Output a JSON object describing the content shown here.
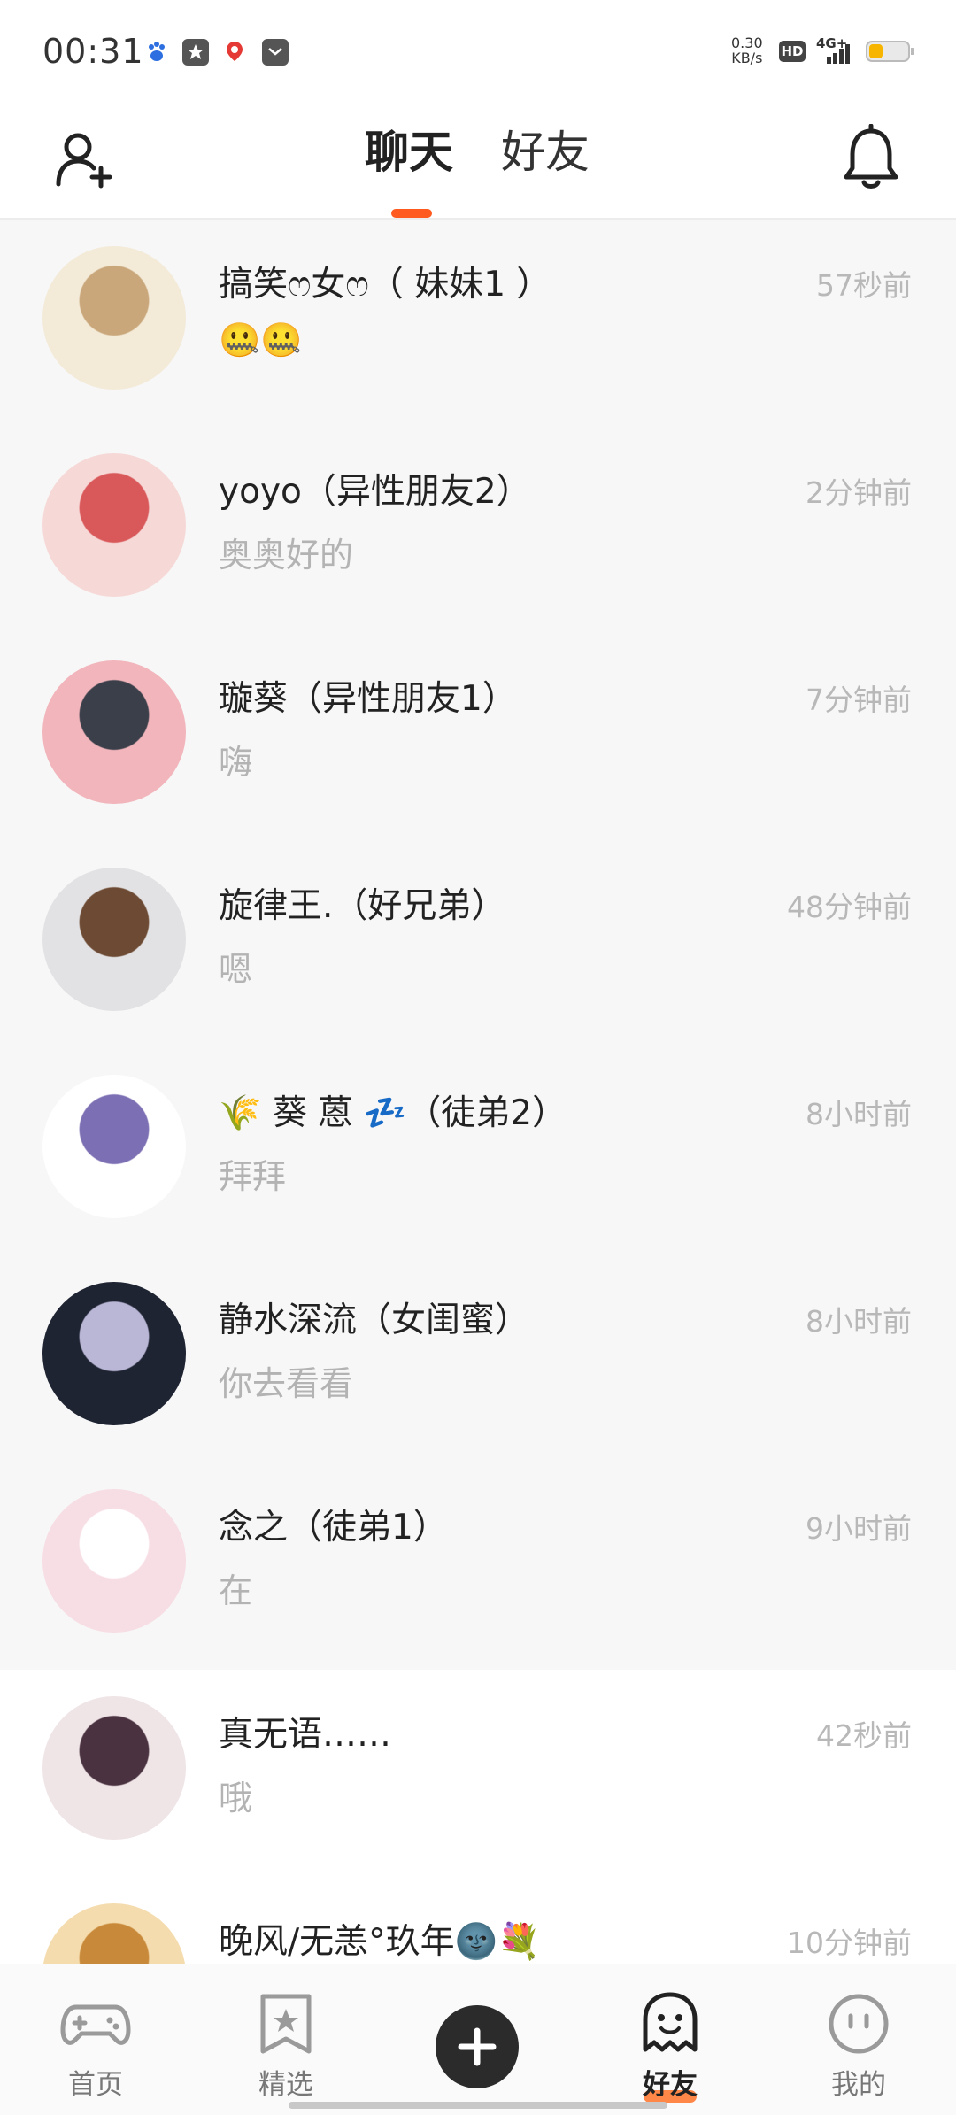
{
  "status_bar": {
    "time": "00:31",
    "net_speed_value": "0.30",
    "net_speed_unit": "KB/s",
    "hd_badge": "HD",
    "network_type": "4G+",
    "notification_icons": [
      "paw-icon",
      "message-star-icon",
      "map-pin-icon",
      "mail-icon"
    ]
  },
  "header": {
    "tabs": [
      {
        "label": "聊天",
        "active": true
      },
      {
        "label": "好友",
        "active": false
      }
    ]
  },
  "chats": [
    {
      "name": "搞笑ෆ女ෆ（ 妹妹1 ）",
      "message": "🤐🤐",
      "time": "57秒前",
      "pinned": true,
      "avatar_colors": [
        "#f3ead8",
        "#c9a77a"
      ]
    },
    {
      "name": "yoyo（异性朋友2）",
      "message": "奥奥好的",
      "time": "2分钟前",
      "pinned": true,
      "avatar_colors": [
        "#f6d9d7",
        "#d9585a"
      ]
    },
    {
      "name": "璇葵（异性朋友1）",
      "message": "嗨",
      "time": "7分钟前",
      "pinned": true,
      "avatar_colors": [
        "#f1b5bb",
        "#3a3f4a"
      ]
    },
    {
      "name": "旋律王.（好兄弟）",
      "message": "嗯",
      "time": "48分钟前",
      "pinned": true,
      "avatar_colors": [
        "#e2e2e4",
        "#6d4a33"
      ]
    },
    {
      "name": "🌾 葵 蒽 💤（徒弟2）",
      "message": "拜拜",
      "time": "8小时前",
      "pinned": true,
      "avatar_colors": [
        "#ffffff",
        "#7d6fb3"
      ]
    },
    {
      "name": "静水深流（女闺蜜）",
      "message": "你去看看",
      "time": "8小时前",
      "pinned": true,
      "avatar_colors": [
        "#1f2433",
        "#b9b6d6"
      ]
    },
    {
      "name": "念之（徒弟1）",
      "message": "在",
      "time": "9小时前",
      "pinned": true,
      "avatar_colors": [
        "#f7dde4",
        "#ffffff"
      ]
    },
    {
      "name": "真无语……",
      "message": "哦",
      "time": "42秒前",
      "pinned": false,
      "avatar_colors": [
        "#efe4e6",
        "#4a3240"
      ]
    },
    {
      "name": "晚风/无恙°玖年🌚💐",
      "message": "",
      "time": "10分钟前",
      "pinned": false,
      "avatar_colors": [
        "#f5dcae",
        "#c88a3a"
      ]
    }
  ],
  "bottom_nav": {
    "items": [
      {
        "label": "首页",
        "icon": "gamepad-icon",
        "active": false
      },
      {
        "label": "精选",
        "icon": "star-bookmark-icon",
        "active": false
      },
      {
        "label": "好友",
        "icon": "ghost-icon",
        "active": true
      },
      {
        "label": "我的",
        "icon": "face-icon",
        "active": false
      }
    ],
    "publish_icon": "plus-icon"
  },
  "colors": {
    "accent": "#ff5a1f",
    "pinned_bg": "#f7f7f7",
    "muted_text": "#b3b3b3"
  }
}
